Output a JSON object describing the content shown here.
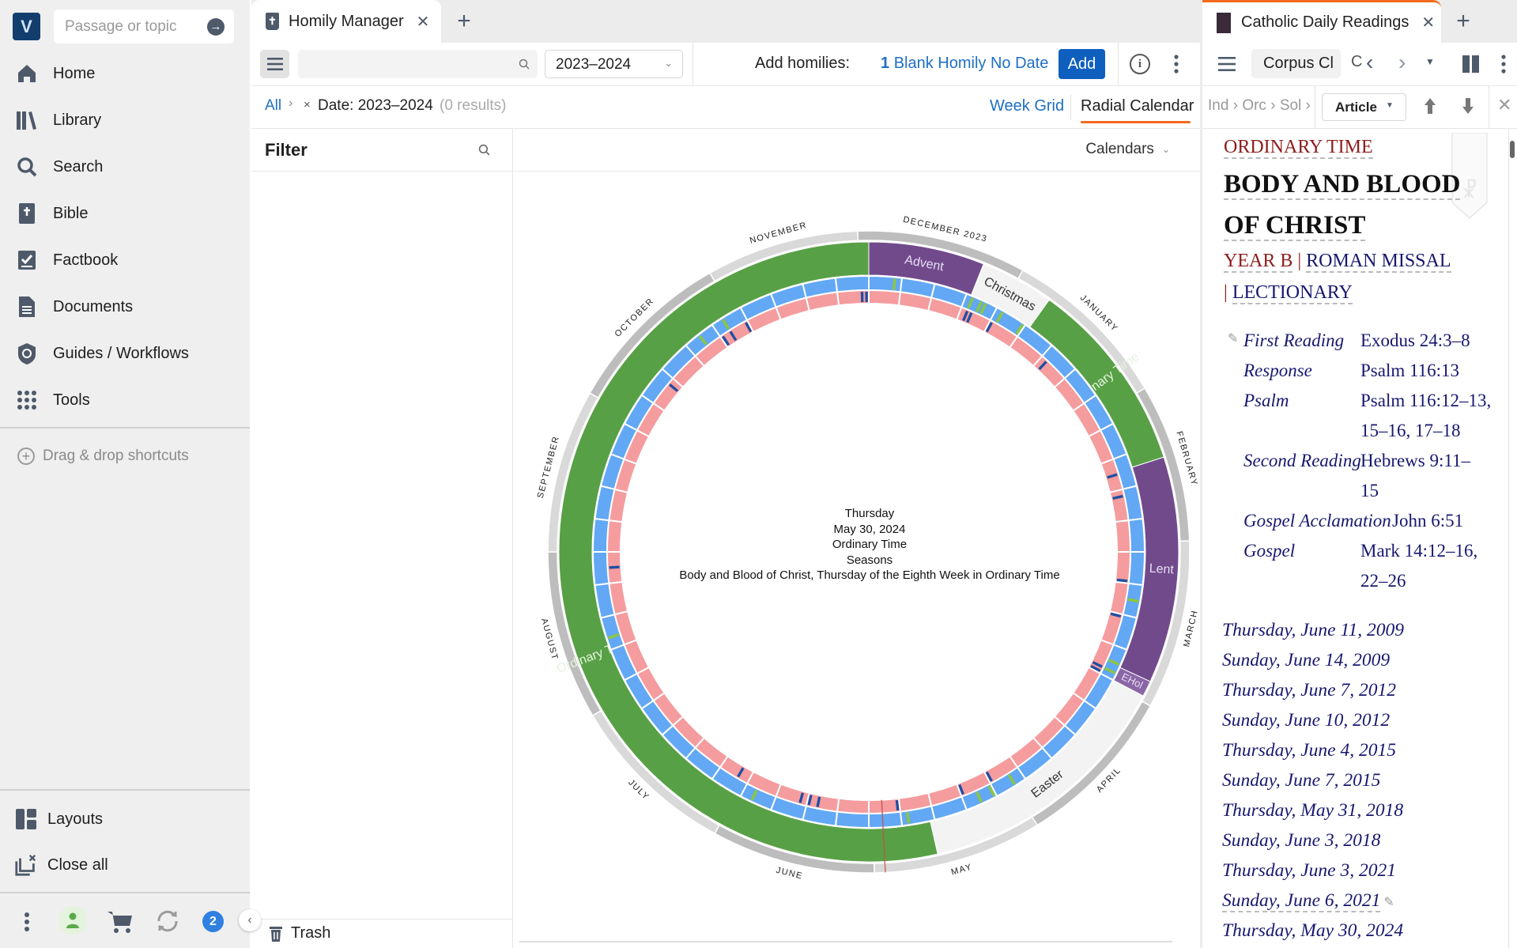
{
  "sidebar": {
    "search_placeholder": "Passage or topic",
    "items": [
      {
        "label": "Home",
        "icon": "home-icon"
      },
      {
        "label": "Library",
        "icon": "library-icon"
      },
      {
        "label": "Search",
        "icon": "search-icon"
      },
      {
        "label": "Bible",
        "icon": "bible-icon"
      },
      {
        "label": "Factbook",
        "icon": "factbook-icon"
      },
      {
        "label": "Documents",
        "icon": "documents-icon"
      },
      {
        "label": "Guides / Workflows",
        "icon": "guides-icon"
      },
      {
        "label": "Tools",
        "icon": "tools-grid-icon"
      }
    ],
    "drag_drop": "Drag & drop shortcuts",
    "layouts": "Layouts",
    "close_all": "Close all",
    "notification_count": "2"
  },
  "homily": {
    "tab_title": "Homily Manager",
    "search_value": "",
    "year_select": "2023–2024",
    "add_label": "Add homilies:",
    "blank_count": "1",
    "blank_label": "Blank Homily No Date",
    "add_button": "Add",
    "breadcrumb_all": "All",
    "breadcrumb_sep": "›",
    "filter_chip": "Date: 2023–2024",
    "results": "(0 results)",
    "view_week": "Week Grid",
    "view_radial": "Radial Calendar",
    "filter_title": "Filter",
    "calendars": "Calendars",
    "trash": "Trash",
    "accent": "#f26b1d"
  },
  "calendar": {
    "center": {
      "weekday": "Thursday",
      "date": "May 30, 2024",
      "season": "Ordinary Time",
      "category": "Seasons",
      "feast": "Body and Blood of Christ, Thursday of the Eighth Week in Ordinary Time"
    },
    "year_days": 364,
    "selected_day": 179,
    "months": [
      {
        "label": "DECEMBER 2023",
        "start": -2,
        "end": 29
      },
      {
        "label": "JANUARY",
        "start": 29,
        "end": 60
      },
      {
        "label": "FEBRUARY",
        "start": 60,
        "end": 89
      },
      {
        "label": "MARCH",
        "start": 89,
        "end": 120
      },
      {
        "label": "APRIL",
        "start": 120,
        "end": 150
      },
      {
        "label": "MAY",
        "start": 150,
        "end": 181
      },
      {
        "label": "JUNE",
        "start": 181,
        "end": 211
      },
      {
        "label": "JULY",
        "start": 211,
        "end": 242
      },
      {
        "label": "AUGUST",
        "start": 242,
        "end": 273
      },
      {
        "label": "SEPTEMBER",
        "start": 273,
        "end": 303
      },
      {
        "label": "OCTOBER",
        "start": 303,
        "end": 334
      },
      {
        "label": "NOVEMBER",
        "start": 334,
        "end": 362
      }
    ],
    "seasons": [
      {
        "label": "Advent",
        "start": 0,
        "end": 22,
        "color": "#714a8c",
        "text": "#e8ddf2"
      },
      {
        "label": "Christmas",
        "start": 22,
        "end": 36,
        "color": "#f3f3f3",
        "text": "#333333"
      },
      {
        "label": "Ordinary Time",
        "start": 36,
        "end": 73,
        "color": "#58a046",
        "text": "#e6f3e0"
      },
      {
        "label": "Lent",
        "start": 73,
        "end": 116,
        "color": "#714a8c",
        "text": "#e8ddf2"
      },
      {
        "label": "EHol",
        "start": 116,
        "end": 119,
        "color": "#8a66a6",
        "text": "#e8ddf2"
      },
      {
        "label": "Easter",
        "start": 119,
        "end": 169,
        "color": "#f3f3f3",
        "text": "#333333"
      },
      {
        "label": "Ordinary Time",
        "start": 169,
        "end": 364,
        "color": "#58a046",
        "text": "#e6f3e0"
      }
    ],
    "week_colors": {
      "outer": "#62a8f5",
      "inner": "#f59c9f"
    },
    "outer_markers": [
      5,
      22,
      24,
      25,
      29,
      34,
      101,
      115,
      117,
      149,
      154,
      157,
      173,
      207,
      254,
      325,
      331
    ],
    "inner_markers": [
      362,
      363,
      22,
      23,
      28,
      43,
      73,
      78,
      97,
      105,
      117,
      118,
      153,
      160,
      175,
      193,
      195,
      197,
      212,
      269,
      313,
      329,
      331,
      335
    ],
    "marker_colors": {
      "outer": "#8cc63f",
      "inner": "#1f4fa3"
    }
  },
  "readings": {
    "tab_title": "Catholic Daily Readings",
    "resource_button": "Corpus Cl",
    "resource_trunc": "C",
    "crumbs": [
      "Ind",
      "Orc",
      "Sol"
    ],
    "view_select": "Article",
    "season": "ORDINARY TIME",
    "title_line1": "BODY AND BLOOD",
    "title_line2": "OF CHRIST",
    "year": "YEAR B",
    "missal": "ROMAN MISSAL",
    "lectionary": "LECTIONARY",
    "sep": "|",
    "rows": [
      {
        "label": "First Reading",
        "value": "Exodus 24:3–8"
      },
      {
        "label": "Response",
        "value": "Psalm 116:13"
      },
      {
        "label": "Psalm",
        "value": "Psalm 116:12–13, 15–16, 17–18"
      },
      {
        "label": "Second Reading",
        "value": "Hebrews 9:11–15"
      },
      {
        "label": "Gospel Acclamation",
        "value": "John 6:51"
      },
      {
        "label": "Gospel",
        "value": "Mark 14:12–16, 22–26"
      }
    ],
    "dates": [
      "Thursday, June 11, 2009",
      "Sunday, June 14, 2009",
      "Thursday, June 7, 2012",
      "Sunday, June 10, 2012",
      "Thursday, June 4, 2015",
      "Sunday, June 7, 2015",
      "Thursday, May 31, 2018",
      "Sunday, June 3, 2018",
      "Thursday, June 3, 2021",
      "Sunday, June 6, 2021",
      "Thursday, May 30, 2024"
    ]
  }
}
